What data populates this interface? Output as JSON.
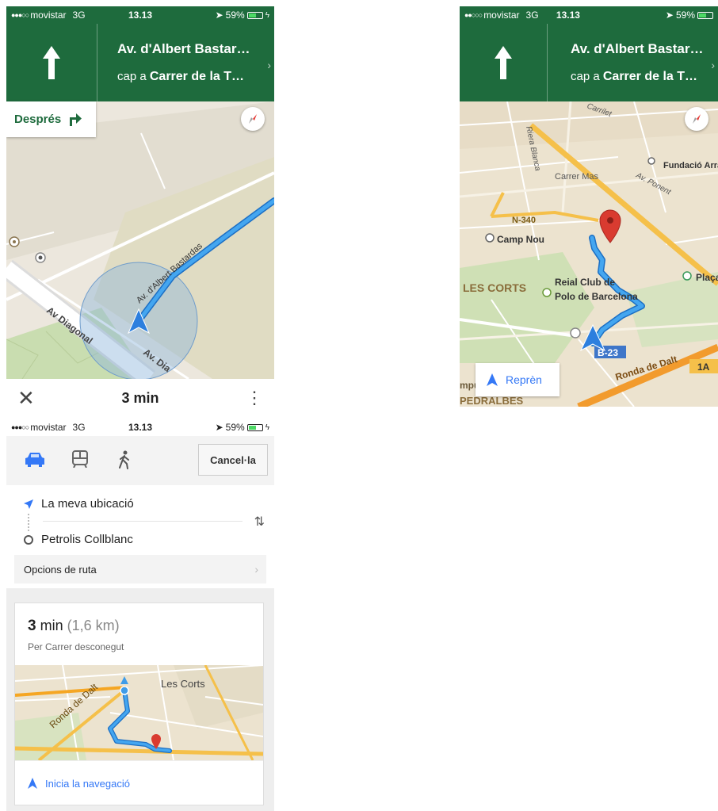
{
  "status_bar": {
    "signal_dots": "●●●○○",
    "signal_dots_top_right": "●●○○○",
    "carrier": "movistar",
    "network": "3G",
    "time": "13.13",
    "battery_percent": "59%",
    "battery_level": 0.59
  },
  "navigation_header": {
    "street": "Av. d'Albert Bastar…",
    "toward_prefix": "cap a",
    "toward_street": "Carrer de la T…"
  },
  "left_map": {
    "next_turn_label": "Després",
    "street_labels": [
      "Av. d'Albert Bastardas",
      "Av Diagonal",
      "Av. Dia"
    ]
  },
  "bottom_bar": {
    "eta": "3 min"
  },
  "right_map": {
    "labels": [
      "Carrilet",
      "Riera Blanca",
      "Carrer Mas",
      "Av. Ponent",
      "Fundació Arra",
      "N-340",
      "Camp Nou",
      "LES CORTS",
      "Reial Club de",
      "Polo de Barcelona",
      "Plaça",
      "B-23",
      "Ronda de Dalt",
      "1A",
      "mpus Nord",
      "PEDRALBES"
    ],
    "recenter_label": "Reprèn"
  },
  "directions": {
    "cancel_label": "Cancel·la",
    "origin": "La meva ubicació",
    "destination": "Petrolis Collblanc",
    "route_options_label": "Opcions de ruta",
    "route": {
      "duration_value": "3",
      "duration_unit": "min",
      "distance": "(1,6 km)",
      "via": "Per Carrer desconegut",
      "map_labels": [
        "Les Corts",
        "Ronda de Dalt"
      ],
      "start_label": "Inicia la navegació"
    }
  },
  "colors": {
    "nav_green": "#1e6b3d",
    "route_blue": "#3f9ce8",
    "link_blue": "#3478f6",
    "highway_orange": "#f5a623",
    "pin_red": "#d93b30"
  }
}
